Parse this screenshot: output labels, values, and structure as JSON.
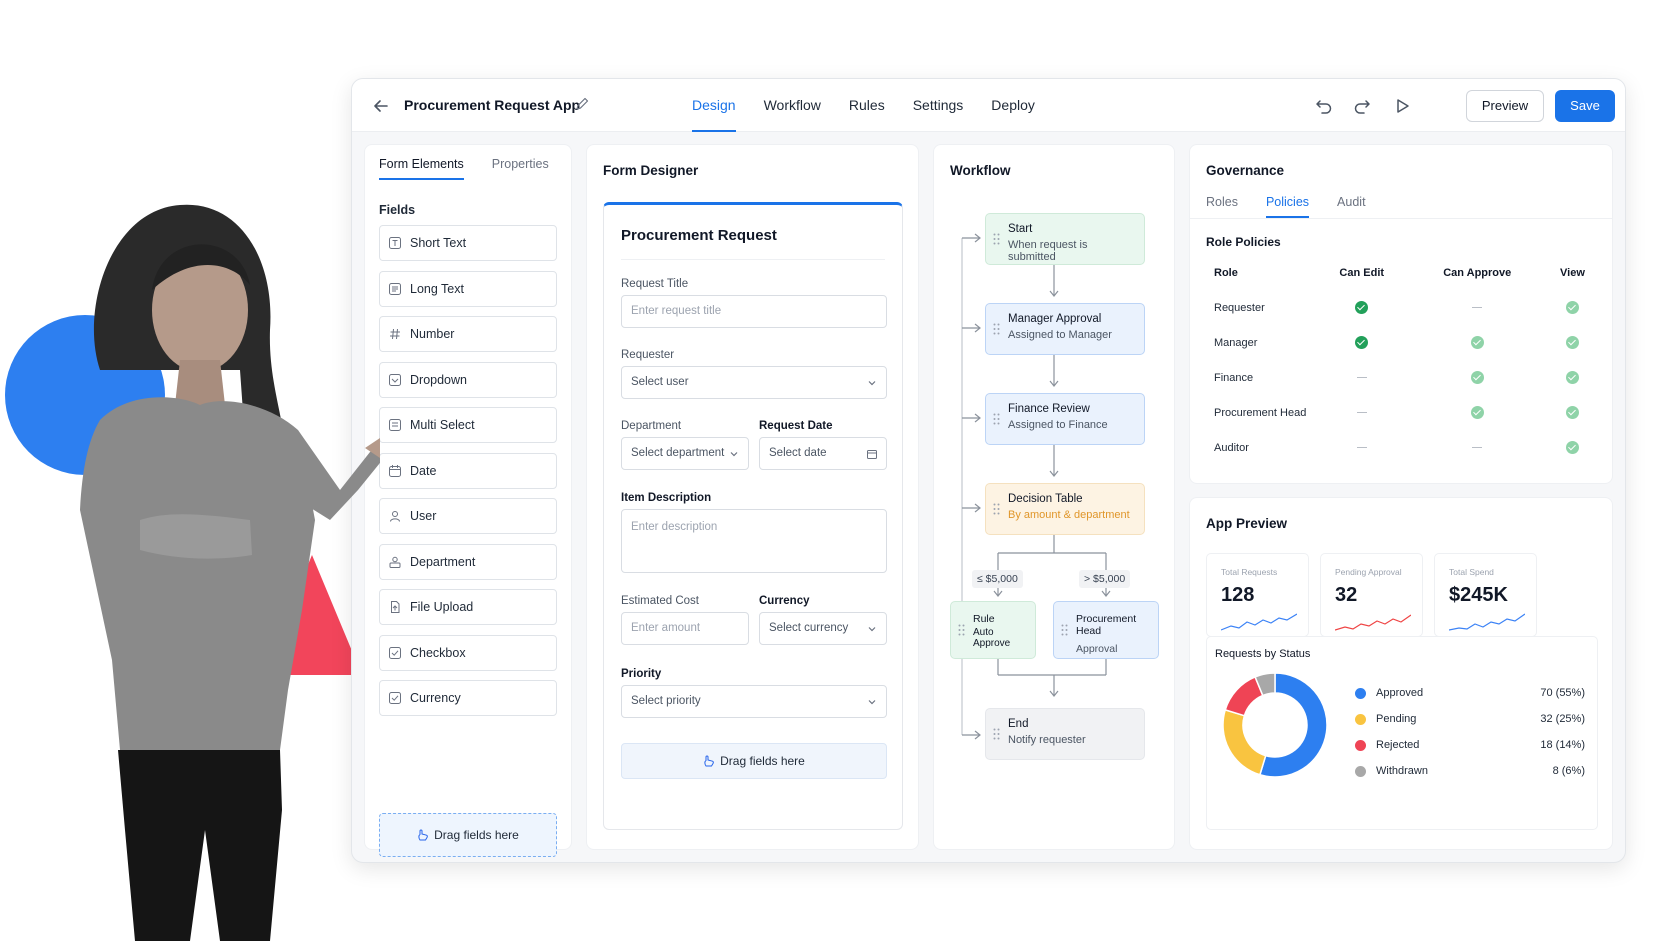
{
  "header": {
    "app_title": "Procurement Request App",
    "tabs": [
      {
        "label": "Design",
        "active": true
      },
      {
        "label": "Workflow",
        "active": false
      },
      {
        "label": "Rules",
        "active": false
      },
      {
        "label": "Settings",
        "active": false
      },
      {
        "label": "Deploy",
        "active": false
      }
    ],
    "preview_label": "Preview",
    "save_label": "Save"
  },
  "elements": {
    "tabs": [
      {
        "label": "Form Elements",
        "active": true
      },
      {
        "label": "Properties",
        "active": false
      }
    ],
    "fields_label": "Fields",
    "fields": [
      {
        "label": "Short Text",
        "icon": "text-icon"
      },
      {
        "label": "Long Text",
        "icon": "paragraph-icon"
      },
      {
        "label": "Number",
        "icon": "hash-icon"
      },
      {
        "label": "Dropdown",
        "icon": "dropdown-icon"
      },
      {
        "label": "Multi Select",
        "icon": "multi-select-icon"
      },
      {
        "label": "Date",
        "icon": "calendar-icon"
      },
      {
        "label": "User",
        "icon": "user-icon"
      },
      {
        "label": "Department",
        "icon": "group-icon"
      },
      {
        "label": "File Upload",
        "icon": "upload-icon"
      },
      {
        "label": "Checkbox",
        "icon": "checkbox-icon"
      },
      {
        "label": "Currency",
        "icon": "currency-icon"
      }
    ],
    "drop_zone": "Drag fields here"
  },
  "designer": {
    "title": "Form Designer",
    "form_title": "Procurement Request",
    "request_title": {
      "label": "Request Title",
      "placeholder": "Enter request title"
    },
    "requester": {
      "label": "Requester",
      "value": "Select user"
    },
    "department": {
      "label": "Department",
      "value": "Select department"
    },
    "request_date": {
      "label": "Request Date",
      "value": "Select date"
    },
    "item_description": {
      "label": "Item Description",
      "placeholder": "Enter description"
    },
    "estimated_cost": {
      "label": "Estimated Cost",
      "placeholder": "Enter amount"
    },
    "currency": {
      "label": "Currency",
      "value": "Select currency"
    },
    "priority": {
      "label": "Priority",
      "value": "Select priority"
    },
    "drop_zone": "Drag fields here"
  },
  "workflow": {
    "title": "Workflow",
    "nodes": {
      "start": {
        "title": "Start",
        "subtitle": "When request is submitted"
      },
      "manager": {
        "title": "Manager Approval",
        "subtitle": "Assigned to Manager"
      },
      "finance": {
        "title": "Finance Review",
        "subtitle": "Assigned to Finance"
      },
      "decision": {
        "title": "Decision Table",
        "subtitle": "By amount & department"
      },
      "auto": {
        "title": "Rule",
        "subtitle": "Auto Approve"
      },
      "head": {
        "title": "Procurement Head",
        "subtitle": "Approval"
      },
      "end": {
        "title": "End",
        "subtitle": "Notify requester"
      }
    },
    "conditions": {
      "low": "≤ $5,000",
      "high": "> $5,000"
    }
  },
  "governance": {
    "title": "Governance",
    "tabs": [
      {
        "label": "Roles",
        "active": false
      },
      {
        "label": "Policies",
        "active": true
      },
      {
        "label": "Audit",
        "active": false
      }
    ],
    "section_label": "Role Policies",
    "columns": [
      "Role",
      "Can Edit",
      "Can Approve",
      "View"
    ],
    "rows": [
      {
        "role": "Requester",
        "edit": "yes",
        "approve": "no",
        "view": "yes"
      },
      {
        "role": "Manager",
        "edit": "yes",
        "approve": "yes",
        "view": "yes"
      },
      {
        "role": "Finance",
        "edit": "no",
        "approve": "yes",
        "view": "yes"
      },
      {
        "role": "Procurement Head",
        "edit": "no",
        "approve": "yes",
        "view": "yes"
      },
      {
        "role": "Auditor",
        "edit": "no",
        "approve": "no",
        "view": "yes"
      }
    ]
  },
  "preview": {
    "title": "App Preview",
    "stats": [
      {
        "label": "Total Requests",
        "value": "128",
        "trend_color": "#3b82f6"
      },
      {
        "label": "Pending Approval",
        "value": "32",
        "trend_color": "#ef4444"
      },
      {
        "label": "Total Spend",
        "value": "$245K",
        "trend_color": "#3b82f6"
      }
    ],
    "status_title": "Requests by Status",
    "status": [
      {
        "name": "Approved",
        "count": 70,
        "text": "70 (55%)",
        "color": "#2d7ff0"
      },
      {
        "name": "Pending",
        "count": 32,
        "text": "32 (25%)",
        "color": "#f9c440"
      },
      {
        "name": "Rejected",
        "count": 18,
        "text": "18 (14%)",
        "color": "#ef4455"
      },
      {
        "name": "Withdrawn",
        "count": 8,
        "text": "8 (6%)",
        "color": "#a8a8a8"
      }
    ]
  },
  "colors": {
    "accent": "#1a73e8",
    "deco_circle": "#2d7ff0",
    "deco_triangle": "#f2455b"
  }
}
